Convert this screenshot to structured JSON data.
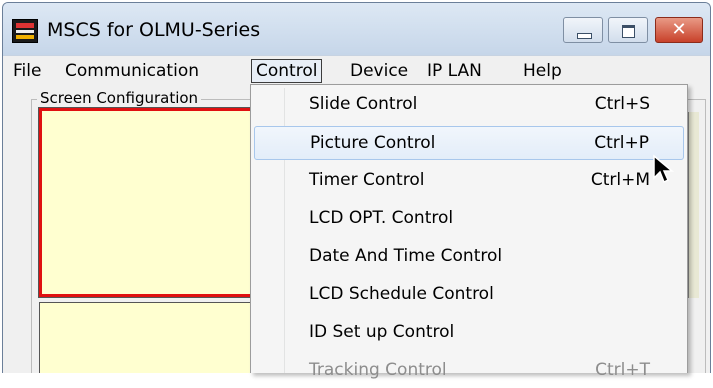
{
  "window": {
    "title": "MSCS for OLMU-Series"
  },
  "titlebar_buttons": {
    "minimize_icon": "minimize-icon",
    "maximize_icon": "maximize-icon",
    "close_glyph": "✕"
  },
  "menubar": {
    "items": [
      {
        "label": "File"
      },
      {
        "label": "Communication"
      },
      {
        "label": "Control",
        "active": true
      },
      {
        "label": "Device"
      },
      {
        "label": "IP LAN"
      },
      {
        "label": "Help"
      }
    ]
  },
  "screen_config": {
    "label": "Screen Configuration"
  },
  "control_menu": {
    "items": [
      {
        "label": "Slide Control",
        "shortcut": "Ctrl+S"
      },
      {
        "label": "Picture Control",
        "shortcut": "Ctrl+P",
        "highlighted": true
      },
      {
        "label": "Timer Control",
        "shortcut": "Ctrl+M"
      },
      {
        "label": "LCD OPT. Control",
        "shortcut": ""
      },
      {
        "label": "Date And Time Control",
        "shortcut": ""
      },
      {
        "label": "LCD Schedule Control",
        "shortcut": ""
      },
      {
        "label": "ID Set up Control",
        "shortcut": ""
      },
      {
        "label": "Tracking Control",
        "shortcut": "Ctrl+T",
        "disabled": true
      }
    ]
  },
  "colors": {
    "titlebar": "#cfdceb",
    "panel_fill": "#ffffd0",
    "selected_border": "#e01010",
    "menu_hover": "#e3edf9"
  }
}
